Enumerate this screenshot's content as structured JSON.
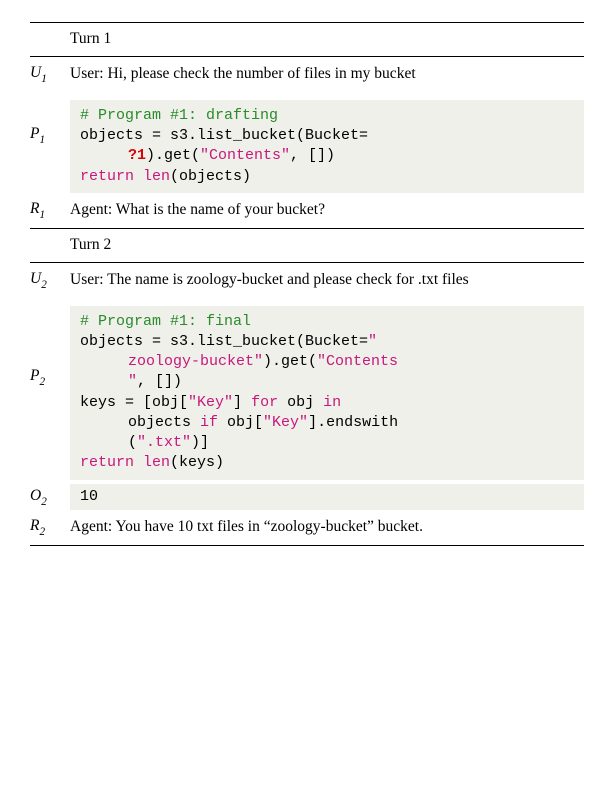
{
  "turn1": {
    "label": "Turn 1",
    "row_U": "U",
    "row_P": "P",
    "row_R": "R",
    "sub": "1",
    "user": "User: Hi, please check the number of files in my bucket",
    "code": {
      "c1": "# Program #1: drafting",
      "l2a": "objects = s3.list_bucket(Bucket=",
      "l3a": "?1",
      "l3b": ").get(",
      "l3c": "\"Contents\"",
      "l3d": ", [])",
      "l4a": "return len",
      "l4b": "(objects)"
    },
    "agent": "Agent: What is the name of your bucket?"
  },
  "turn2": {
    "label": "Turn 2",
    "row_U": "U",
    "row_P": "P",
    "row_O": "O",
    "row_R": "R",
    "sub": "2",
    "user": "User: The name is zoology-bucket and please check for .txt files",
    "code": {
      "c1": "# Program #1: final",
      "l2a": "objects = s3.list_bucket(Bucket=",
      "l2b": "\"",
      "l3a": "zoology-bucket\"",
      "l3b": ").get(",
      "l3c": "\"Contents",
      "l4a": "\"",
      "l4b": ", [])",
      "l5a": "keys = [obj[",
      "l5b": "\"Key\"",
      "l5c": "] ",
      "l5d": "for",
      "l5e": " obj ",
      "l5f": "in",
      "l6a": "objects ",
      "l6b": "if",
      "l6c": " obj[",
      "l6d": "\"Key\"",
      "l6e": "].endswith",
      "l7a": "(",
      "l7b": "\".txt\"",
      "l7c": ")]",
      "l8a": "return len",
      "l8b": "(keys)"
    },
    "output": "10",
    "agent": "Agent: You have 10 txt files in “zoology-bucket” bucket."
  }
}
